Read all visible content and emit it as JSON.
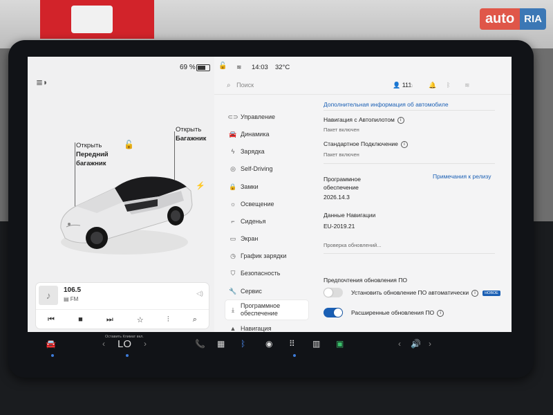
{
  "watermark": {
    "part1": "auto",
    "part2": "RIA"
  },
  "status_bar": {
    "battery": "69 %",
    "time": "14:03",
    "temperature": "32°C"
  },
  "car": {
    "label_front": [
      "Открыть",
      "Передний",
      "багажник"
    ],
    "label_trunk": [
      "Открыть",
      "Багажник"
    ]
  },
  "media": {
    "frequency": "106.5",
    "band": "FM"
  },
  "header": {
    "search_placeholder": "Поиск",
    "profile_count": "111"
  },
  "menu": [
    {
      "label": "Управление",
      "icon": "toggle-icon"
    },
    {
      "label": "Динамика",
      "icon": "car-icon"
    },
    {
      "label": "Зарядка",
      "icon": "bolt-icon"
    },
    {
      "label": "Self-Driving",
      "icon": "steering-wheel-icon"
    },
    {
      "label": "Замки",
      "icon": "lock-icon"
    },
    {
      "label": "Освещение",
      "icon": "sun-icon"
    },
    {
      "label": "Сиденья",
      "icon": "seat-icon"
    },
    {
      "label": "Экран",
      "icon": "screen-icon"
    },
    {
      "label": "График зарядки",
      "icon": "clock-icon"
    },
    {
      "label": "Безопасность",
      "icon": "shield-icon"
    },
    {
      "label": "Сервис",
      "icon": "wrench-icon"
    },
    {
      "label": "Программное обеспечение",
      "icon": "download-icon",
      "active": true
    },
    {
      "label": "Навигация",
      "icon": "navigation-icon"
    }
  ],
  "software": {
    "extra_info_link": "Дополнительная информация об автомобиле",
    "autopilot_nav_title": "Навигация с Автопилотом",
    "autopilot_nav_status": "Пакет включен",
    "standard_conn_title": "Стандартное Подключение",
    "standard_conn_status": "Пакет включен",
    "software_title_1": "Программное",
    "software_title_2": "обеспечение",
    "release_notes_link": "Примечания к релизу",
    "version": "2026.14.3",
    "nav_data_title": "Данные Навигации",
    "nav_data_version": "EU-2019.21",
    "check_updates": "Проверка обновлений...",
    "update_prefs_title": "Предпочтения обновления ПО",
    "auto_install_label": "Установить обновление ПО автоматически",
    "auto_install_on": false,
    "new_badge": "НОВОЕ",
    "advanced_updates_label": "Расширенные обновления ПО",
    "advanced_updates_on": true
  },
  "dock": {
    "climate_hint": "Оставить Климат вкл.",
    "temp_mode": "LO"
  },
  "colors": {
    "accent": "#1a5fb4",
    "toggle_on": "#1a5fb4",
    "toggle_off": "#dcdcdc"
  }
}
